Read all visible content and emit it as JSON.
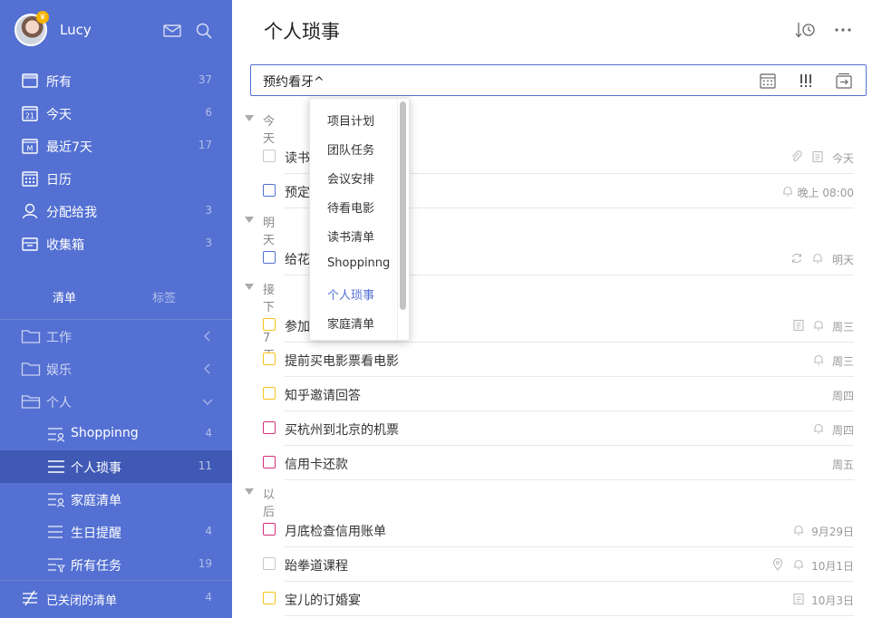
{
  "user": {
    "name": "Lucy"
  },
  "smart_lists": [
    {
      "label": "所有",
      "count": "37",
      "icon": "inbox-tray-icon"
    },
    {
      "label": "今天",
      "count": "6",
      "icon": "calendar-day-icon",
      "day": "21"
    },
    {
      "label": "最近7天",
      "count": "17",
      "icon": "calendar-week-icon",
      "day": "M"
    },
    {
      "label": "日历",
      "count": "",
      "icon": "calendar-grid-icon"
    },
    {
      "label": "分配给我",
      "count": "3",
      "icon": "person-icon"
    },
    {
      "label": "收集箱",
      "count": "3",
      "icon": "collect-box-icon"
    }
  ],
  "tabs": {
    "lists": "清单",
    "tags": "标签"
  },
  "folders": [
    {
      "label": "工作",
      "expanded": false
    },
    {
      "label": "娱乐",
      "expanded": false
    },
    {
      "label": "个人",
      "expanded": true
    }
  ],
  "sub_lists": [
    {
      "label": "Shoppinng",
      "count": "4"
    },
    {
      "label": "个人琐事",
      "count": "11",
      "active": true
    },
    {
      "label": "家庭清单",
      "count": ""
    },
    {
      "label": "生日提醒",
      "count": "4"
    },
    {
      "label": "所有任务",
      "count": "19"
    }
  ],
  "closed_lists": {
    "label": "已关闭的清单",
    "count": "4"
  },
  "main": {
    "title": "个人琐事",
    "add_input_value": "预约看牙^"
  },
  "sections": [
    {
      "label": "今天"
    },
    {
      "label": "明天"
    },
    {
      "label": "接下来7天"
    },
    {
      "label": "以后"
    }
  ],
  "tasks": [
    {
      "title": "读书",
      "date": "今天",
      "priority_color": "#c8c8c8"
    },
    {
      "title": "预定",
      "date": "晚上 08:00",
      "priority_color": "#5470d2"
    },
    {
      "title": "给花",
      "date": "明天",
      "priority_color": "#5470d2"
    },
    {
      "title": "参加",
      "date": "周三",
      "priority_color": "#f5c518"
    },
    {
      "title": "提前买电影票看电影",
      "date": "周三",
      "priority_color": "#f5c518"
    },
    {
      "title": "知乎邀请回答",
      "date": "周四",
      "priority_color": "#f5c518"
    },
    {
      "title": "买杭州到北京的机票",
      "date": "周四",
      "priority_color": "#d4317a"
    },
    {
      "title": "信用卡还款",
      "date": "周五",
      "priority_color": "#d4317a"
    },
    {
      "title": "月底检查信用账单",
      "date": "9月29日",
      "priority_color": "#d4317a"
    },
    {
      "title": "跆拳道课程",
      "date": "10月1日",
      "priority_color": "#c8c8c8"
    },
    {
      "title": "宝儿的订婚宴",
      "date": "10月3日",
      "priority_color": "#f5c518"
    }
  ],
  "dropdown": {
    "items": [
      "项目计划",
      "团队任务",
      "会议安排",
      "待看电影",
      "读书清单",
      "Shoppinng",
      "个人琐事",
      "家庭清单"
    ],
    "selected": "个人琐事"
  },
  "colors": {
    "sidebar": "#5470d2",
    "sidebar_active": "#3f59b5",
    "accent": "#5470d2"
  }
}
